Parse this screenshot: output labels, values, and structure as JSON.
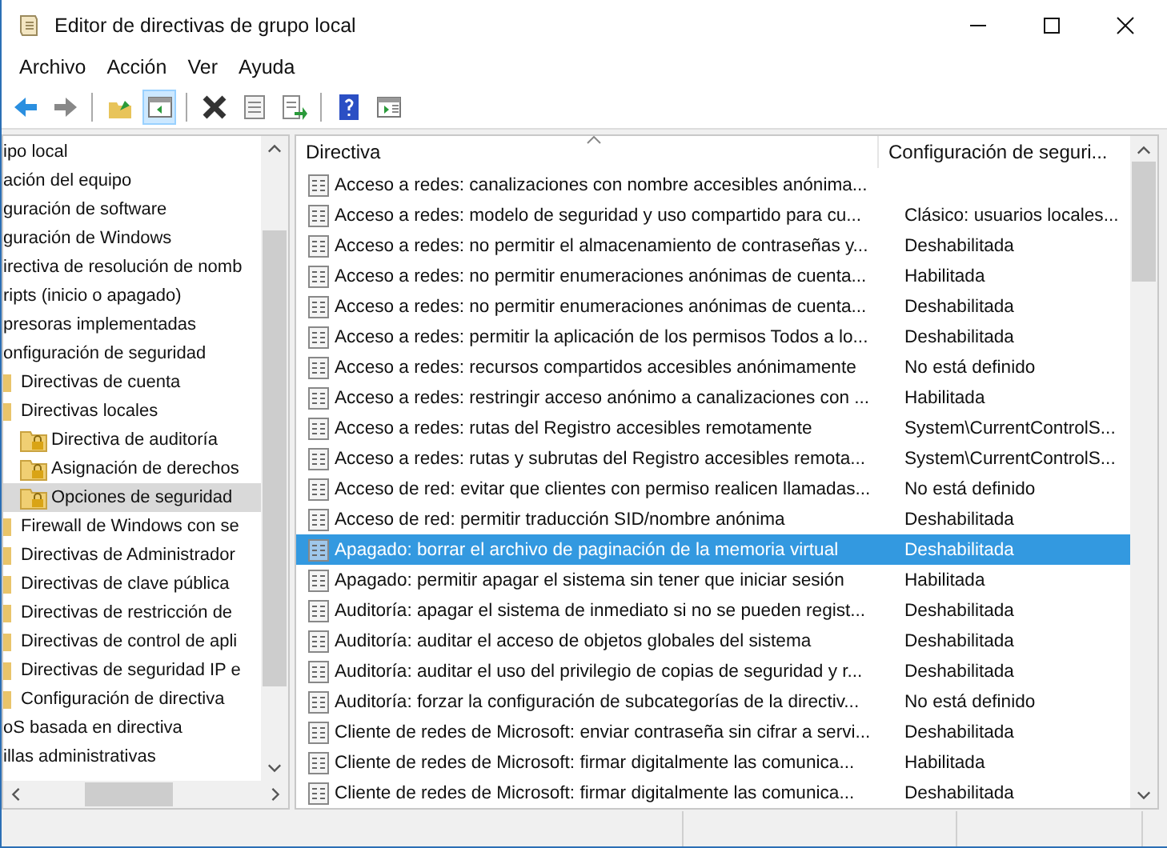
{
  "window": {
    "title": "Editor de directivas de grupo local"
  },
  "menu": [
    "Archivo",
    "Acción",
    "Ver",
    "Ayuda"
  ],
  "toolbar": [
    {
      "kind": "back",
      "pressed": false
    },
    {
      "kind": "forward",
      "pressed": false
    },
    {
      "kind": "separator"
    },
    {
      "kind": "up",
      "pressed": false
    },
    {
      "kind": "tree",
      "pressed": true
    },
    {
      "kind": "separator"
    },
    {
      "kind": "delete",
      "pressed": false
    },
    {
      "kind": "properties",
      "pressed": false
    },
    {
      "kind": "export",
      "pressed": false
    },
    {
      "kind": "separator"
    },
    {
      "kind": "help",
      "pressed": false
    },
    {
      "kind": "actionpane",
      "pressed": false
    }
  ],
  "tree": [
    {
      "label": "ipo local",
      "selected": false,
      "children": [
        {
          "label": "ación del equipo",
          "selected": false,
          "children": [
            {
              "label": "guración de software",
              "selected": false
            },
            {
              "label": "guración de Windows",
              "selected": false,
              "children": [
                {
                  "label": "irectiva de resolución de nomb",
                  "selected": false
                },
                {
                  "label": "ripts (inicio o apagado)",
                  "selected": false
                },
                {
                  "label": "presoras implementadas",
                  "selected": false
                },
                {
                  "label": "onfiguración de seguridad",
                  "selected": false,
                  "children": [
                    {
                      "label": "Directivas de cuenta",
                      "selected": false
                    },
                    {
                      "label": "Directivas locales",
                      "selected": false,
                      "children": [
                        {
                          "label": "Directiva de auditoría",
                          "selected": false
                        },
                        {
                          "label": "Asignación de derechos",
                          "selected": false
                        },
                        {
                          "label": "Opciones de seguridad",
                          "selected": true
                        }
                      ]
                    },
                    {
                      "label": "Firewall de Windows con se",
                      "selected": false
                    },
                    {
                      "label": "Directivas de Administrador",
                      "selected": false
                    },
                    {
                      "label": "Directivas de clave pública",
                      "selected": false
                    },
                    {
                      "label": "Directivas de restricción de",
                      "selected": false
                    },
                    {
                      "label": "Directivas de control de apli",
                      "selected": false
                    },
                    {
                      "label": "Directivas de seguridad IP e",
                      "selected": false
                    },
                    {
                      "label": "Configuración de directiva",
                      "selected": false
                    }
                  ]
                },
                {
                  "label": "oS basada en directiva",
                  "selected": false
                }
              ]
            },
            {
              "label": "illas administrativas",
              "selected": false
            }
          ]
        }
      ]
    }
  ],
  "table": {
    "columns": [
      "Directiva",
      "Configuración de seguri..."
    ],
    "rows": [
      {
        "policy": "Acceso a redes: canalizaciones con nombre accesibles anónima...",
        "selected": false
      },
      {
        "policy": "Acceso a redes: modelo de seguridad y uso compartido para cu...",
        "setting": "Clásico: usuarios locales...",
        "selected": false
      },
      {
        "policy": "Acceso a redes: no permitir el almacenamiento de contraseñas y...",
        "setting": "Deshabilitada",
        "selected": false
      },
      {
        "policy": "Acceso a redes: no permitir enumeraciones anónimas de cuenta...",
        "setting": "Habilitada",
        "selected": false
      },
      {
        "policy": "Acceso a redes: no permitir enumeraciones anónimas de cuenta...",
        "setting": "Deshabilitada",
        "selected": false
      },
      {
        "policy": "Acceso a redes: permitir la aplicación de los permisos Todos a lo...",
        "setting": "Deshabilitada",
        "selected": false
      },
      {
        "policy": "Acceso a redes: recursos compartidos accesibles anónimamente",
        "setting": "No está definido",
        "selected": false
      },
      {
        "policy": "Acceso a redes: restringir acceso anónimo a canalizaciones con ...",
        "setting": "Habilitada",
        "selected": false
      },
      {
        "policy": "Acceso a redes: rutas del Registro accesibles remotamente",
        "setting": "System\\CurrentControlS...",
        "selected": false
      },
      {
        "policy": "Acceso a redes: rutas y subrutas del Registro accesibles remota...",
        "setting": "System\\CurrentControlS...",
        "selected": false
      },
      {
        "policy": "Acceso de red: evitar que clientes con permiso realicen llamadas...",
        "setting": "No está definido",
        "selected": false
      },
      {
        "policy": "Acceso de red: permitir traducción SID/nombre anónima",
        "setting": "Deshabilitada",
        "selected": false
      },
      {
        "policy": "Apagado: borrar el archivo de paginación de la memoria virtual",
        "setting": "Deshabilitada",
        "selected": true
      },
      {
        "policy": "Apagado: permitir apagar el sistema sin tener que iniciar sesión",
        "setting": "Habilitada",
        "selected": false
      },
      {
        "policy": "Auditoría: apagar el sistema de inmediato si no se pueden regist...",
        "setting": "Deshabilitada",
        "selected": false
      },
      {
        "policy": "Auditoría: auditar el acceso de objetos globales del sistema",
        "setting": "Deshabilitada",
        "selected": false
      },
      {
        "policy": "Auditoría: auditar el uso del privilegio de copias de seguridad y r...",
        "setting": "Deshabilitada",
        "selected": false
      },
      {
        "policy": "Auditoría: forzar la configuración de subcategorías de la directiv...",
        "setting": "No está definido",
        "selected": false
      },
      {
        "policy": "Cliente de redes de Microsoft: enviar contraseña sin cifrar a servi...",
        "setting": "Deshabilitada",
        "selected": false
      },
      {
        "policy": "Cliente de redes de Microsoft: firmar digitalmente las comunica...",
        "setting": "Habilitada",
        "selected": false
      },
      {
        "policy": "Cliente de redes de Microsoft: firmar digitalmente las comunica...",
        "setting": "Deshabilitada",
        "selected": false
      }
    ]
  }
}
